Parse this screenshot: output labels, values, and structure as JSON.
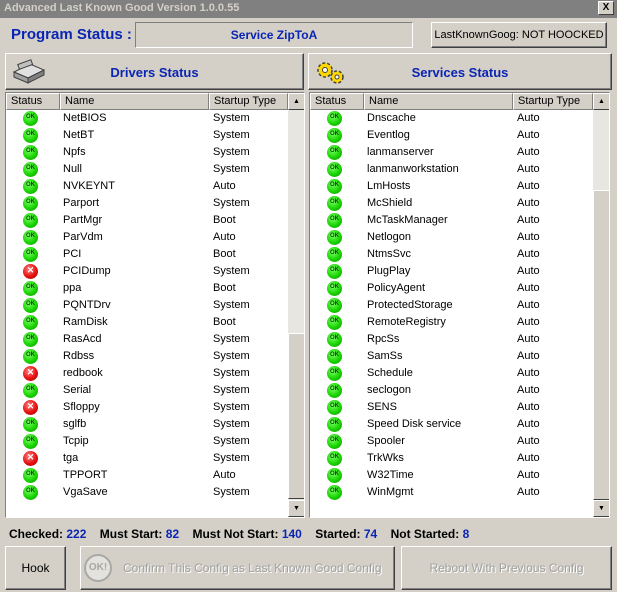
{
  "window": {
    "title": "Advanced Last Known Good Version 1.0.0.55",
    "close_label": "X"
  },
  "header": {
    "program_status_label": "Program Status :",
    "program_status_value": "Service ZipToA",
    "lkg_status": "LastKnownGoog: NOT HOOCKED"
  },
  "drivers": {
    "title": "Drivers Status",
    "columns": [
      "Status",
      "Name",
      "Startup Type"
    ],
    "rows": [
      {
        "status": "ok",
        "name": "NetBIOS",
        "startup": "System"
      },
      {
        "status": "ok",
        "name": "NetBT",
        "startup": "System"
      },
      {
        "status": "ok",
        "name": "Npfs",
        "startup": "System"
      },
      {
        "status": "ok",
        "name": "Null",
        "startup": "System"
      },
      {
        "status": "ok",
        "name": "NVKEYNT",
        "startup": "Auto"
      },
      {
        "status": "ok",
        "name": "Parport",
        "startup": "System"
      },
      {
        "status": "ok",
        "name": "PartMgr",
        "startup": "Boot"
      },
      {
        "status": "ok",
        "name": "ParVdm",
        "startup": "Auto"
      },
      {
        "status": "ok",
        "name": "PCI",
        "startup": "Boot"
      },
      {
        "status": "error",
        "name": "PCIDump",
        "startup": "System"
      },
      {
        "status": "ok",
        "name": "ppa",
        "startup": "Boot"
      },
      {
        "status": "ok",
        "name": "PQNTDrv",
        "startup": "System"
      },
      {
        "status": "ok",
        "name": "RamDisk",
        "startup": "Boot"
      },
      {
        "status": "ok",
        "name": "RasAcd",
        "startup": "System"
      },
      {
        "status": "ok",
        "name": "Rdbss",
        "startup": "System"
      },
      {
        "status": "error",
        "name": "redbook",
        "startup": "System"
      },
      {
        "status": "ok",
        "name": "Serial",
        "startup": "System"
      },
      {
        "status": "error",
        "name": "Sfloppy",
        "startup": "System"
      },
      {
        "status": "ok",
        "name": "sglfb",
        "startup": "System"
      },
      {
        "status": "ok",
        "name": "Tcpip",
        "startup": "System"
      },
      {
        "status": "error",
        "name": "tga",
        "startup": "System"
      },
      {
        "status": "ok",
        "name": "TPPORT",
        "startup": "Auto"
      },
      {
        "status": "ok",
        "name": "VgaSave",
        "startup": "System"
      }
    ]
  },
  "services": {
    "title": "Services Status",
    "columns": [
      "Status",
      "Name",
      "Startup Type"
    ],
    "rows": [
      {
        "status": "ok",
        "name": "Dnscache",
        "startup": "Auto"
      },
      {
        "status": "ok",
        "name": "Eventlog",
        "startup": "Auto"
      },
      {
        "status": "ok",
        "name": "lanmanserver",
        "startup": "Auto"
      },
      {
        "status": "ok",
        "name": "lanmanworkstation",
        "startup": "Auto"
      },
      {
        "status": "ok",
        "name": "LmHosts",
        "startup": "Auto"
      },
      {
        "status": "ok",
        "name": "McShield",
        "startup": "Auto"
      },
      {
        "status": "ok",
        "name": "McTaskManager",
        "startup": "Auto"
      },
      {
        "status": "ok",
        "name": "Netlogon",
        "startup": "Auto"
      },
      {
        "status": "ok",
        "name": "NtmsSvc",
        "startup": "Auto"
      },
      {
        "status": "ok",
        "name": "PlugPlay",
        "startup": "Auto"
      },
      {
        "status": "ok",
        "name": "PolicyAgent",
        "startup": "Auto"
      },
      {
        "status": "ok",
        "name": "ProtectedStorage",
        "startup": "Auto"
      },
      {
        "status": "ok",
        "name": "RemoteRegistry",
        "startup": "Auto"
      },
      {
        "status": "ok",
        "name": "RpcSs",
        "startup": "Auto"
      },
      {
        "status": "ok",
        "name": "SamSs",
        "startup": "Auto"
      },
      {
        "status": "ok",
        "name": "Schedule",
        "startup": "Auto"
      },
      {
        "status": "ok",
        "name": "seclogon",
        "startup": "Auto"
      },
      {
        "status": "ok",
        "name": "SENS",
        "startup": "Auto"
      },
      {
        "status": "ok",
        "name": "Speed Disk service",
        "startup": "Auto"
      },
      {
        "status": "ok",
        "name": "Spooler",
        "startup": "Auto"
      },
      {
        "status": "ok",
        "name": "TrkWks",
        "startup": "Auto"
      },
      {
        "status": "ok",
        "name": "W32Time",
        "startup": "Auto"
      },
      {
        "status": "ok",
        "name": "WinMgmt",
        "startup": "Auto"
      }
    ]
  },
  "stats": {
    "checked_label": "Checked:",
    "checked": "222",
    "must_start_label": "Must Start:",
    "must_start": "82",
    "must_not_start_label": "Must Not Start:",
    "must_not_start": "140",
    "started_label": "Started:",
    "started": "74",
    "not_started_label": "Not Started:",
    "not_started": "8"
  },
  "buttons": {
    "hook": "Hook",
    "confirm_icon": "OK!",
    "confirm": "Confirm This Config as Last Known Good Config",
    "reboot": "Reboot With Previous Config"
  },
  "icons": {
    "ok": "ok-status-icon",
    "error": "error-status-icon",
    "drivers": "drive-icon",
    "services": "gears-icon"
  },
  "colors": {
    "accent": "#0a24b4",
    "ok": "#19d400",
    "error": "#e61010",
    "face": "#d4d0c8"
  }
}
